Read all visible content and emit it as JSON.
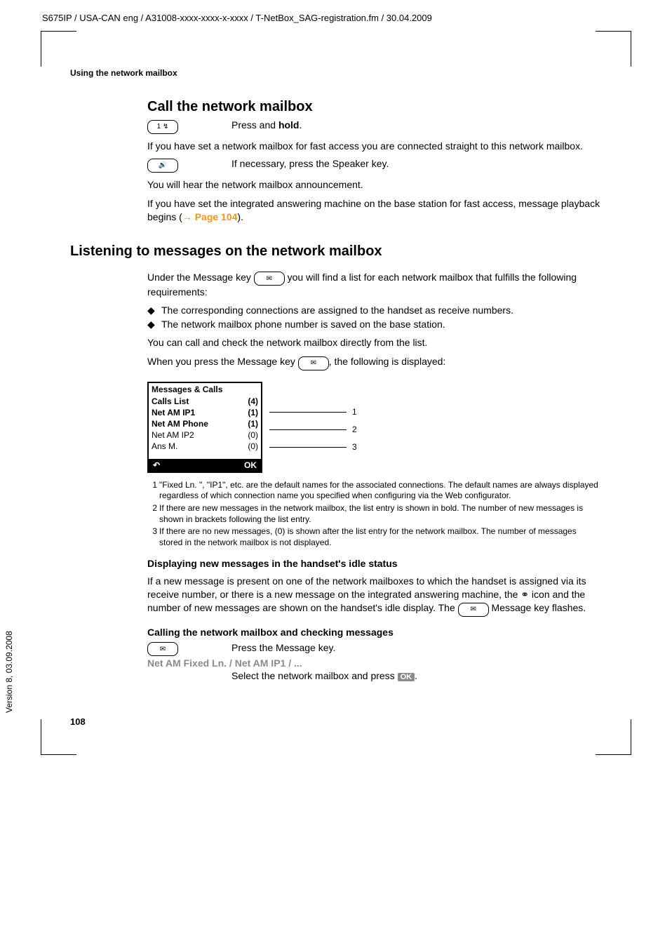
{
  "header": {
    "path": "S675IP  / USA-CAN eng / A31008-xxxx-xxxx-x-xxxx / T-NetBox_SAG-registration.fm / 30.04.2009"
  },
  "running_head": "Using the network mailbox",
  "call_mailbox": {
    "title": "Call the network mailbox",
    "key1": "1 ↯",
    "step1_text": "Press and ",
    "step1_bold": "hold",
    "step1_tail": ".",
    "para1": "If you have set a network mailbox for fast access you are connected straight to this network mailbox.",
    "key2": "🔊",
    "step2_text": "If necessary, press the Speaker key.",
    "para2": "You will hear the network mailbox announcement.",
    "para3a": "If you have set the integrated answering machine on the base station for fast access, message playback begins (",
    "arrow": "→",
    "page_ref": "Page 104",
    "para3b": ")."
  },
  "listening": {
    "title": "Listening to messages on the network mailbox",
    "intro_a": "Under the Message key ",
    "msg_key": "✉",
    "intro_b": " you will find a list for each network mailbox that fulfills the following requirements:",
    "bullet1": "The corresponding connections are assigned to the handset as receive numbers.",
    "bullet2": "The network mailbox phone number is saved on the base station.",
    "para_check": "You can call and check the network mailbox directly from the list.",
    "para_press_a": "When you press the Message key ",
    "para_press_b": ", the following is displayed:"
  },
  "screen": {
    "title": "Messages & Calls",
    "rows": [
      {
        "label": "Calls List",
        "count": "(4)",
        "bold": true
      },
      {
        "label": "Net AM  IP1",
        "count": "(1)",
        "bold": true
      },
      {
        "label": "Net AM Phone",
        "count": "(1)",
        "bold": true
      },
      {
        "label": "Net AM  IP2",
        "count": "(0)",
        "bold": false
      },
      {
        "label": "Ans M.",
        "count": "(0)",
        "bold": false
      }
    ],
    "footer_left": "↶",
    "footer_right": "OK",
    "leaders": [
      "1",
      "2",
      "3"
    ]
  },
  "footnotes": {
    "f1": "\"Fixed Ln. \", \"IP1\", etc. are the default names for the associated connections. The default names are always displayed regardless of which connection name you specified when configuring via the Web configurator.",
    "f2": "If there are new messages in the network mailbox, the list entry is shown in bold. The number of new messages is shown in brackets following the list entry.",
    "f3": "If there are no new messages, (0) is shown after the list entry for the network mailbox. The number of messages stored in the network mailbox is not displayed."
  },
  "displaying": {
    "title": "Displaying new messages in the handset's idle status",
    "para_a": "If a new message is present on one of the network mailboxes to which the handset is assigned via its receive number, or there is a new message on the integrated answering machine, the ",
    "tape_icon": "⚭",
    "para_b": " icon and the number of new messages are shown on the handset's idle display. The ",
    "para_c": " Message key flashes."
  },
  "calling": {
    "title": "Calling the network mailbox and checking messages",
    "step1": "Press the Message key.",
    "label": "Net AM  Fixed Ln. / Net AM IP1 / ...",
    "step2_a": "Select the network mailbox and press ",
    "ok": "OK",
    "step2_b": "."
  },
  "page_number": "108",
  "side_text": "Version 8, 03.09.2008"
}
